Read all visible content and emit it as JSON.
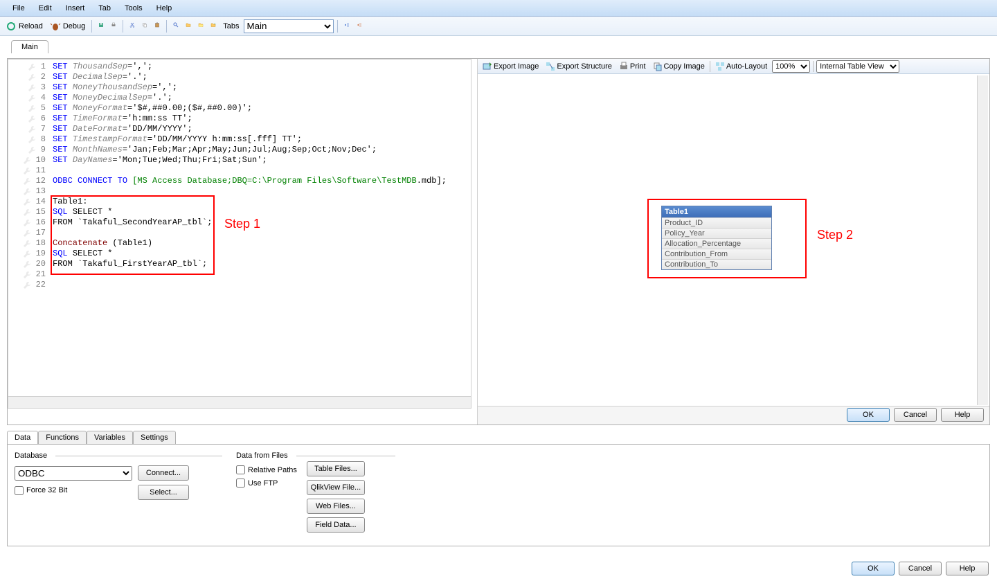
{
  "menu": {
    "file": "File",
    "edit": "Edit",
    "insert": "Insert",
    "tab": "Tab",
    "tools": "Tools",
    "help": "Help"
  },
  "toolbar": {
    "reload": "Reload",
    "debug": "Debug",
    "tabs_label": "Tabs",
    "tabs_value": "Main"
  },
  "main_tab": "Main",
  "code": [
    {
      "n": 1,
      "seg": [
        {
          "c": "kw-set",
          "t": "SET "
        },
        {
          "c": "ident",
          "t": "ThousandSep"
        },
        {
          "c": "",
          "t": "=',';"
        }
      ]
    },
    {
      "n": 2,
      "seg": [
        {
          "c": "kw-set",
          "t": "SET "
        },
        {
          "c": "ident",
          "t": "DecimalSep"
        },
        {
          "c": "",
          "t": "='.';"
        }
      ]
    },
    {
      "n": 3,
      "seg": [
        {
          "c": "kw-set",
          "t": "SET "
        },
        {
          "c": "ident",
          "t": "MoneyThousandSep"
        },
        {
          "c": "",
          "t": "=',';"
        }
      ]
    },
    {
      "n": 4,
      "seg": [
        {
          "c": "kw-set",
          "t": "SET "
        },
        {
          "c": "ident",
          "t": "MoneyDecimalSep"
        },
        {
          "c": "",
          "t": "='.';"
        }
      ]
    },
    {
      "n": 5,
      "seg": [
        {
          "c": "kw-set",
          "t": "SET "
        },
        {
          "c": "ident",
          "t": "MoneyFormat"
        },
        {
          "c": "",
          "t": "='$#,##0.00;($#,##0.00)';"
        }
      ]
    },
    {
      "n": 6,
      "seg": [
        {
          "c": "kw-set",
          "t": "SET "
        },
        {
          "c": "ident",
          "t": "TimeFormat"
        },
        {
          "c": "",
          "t": "='h:mm:ss TT';"
        }
      ]
    },
    {
      "n": 7,
      "seg": [
        {
          "c": "kw-set",
          "t": "SET "
        },
        {
          "c": "ident",
          "t": "DateFormat"
        },
        {
          "c": "",
          "t": "='DD/MM/YYYY';"
        }
      ]
    },
    {
      "n": 8,
      "seg": [
        {
          "c": "kw-set",
          "t": "SET "
        },
        {
          "c": "ident",
          "t": "TimestampFormat"
        },
        {
          "c": "",
          "t": "='DD/MM/YYYY h:mm:ss[.fff] TT';"
        }
      ]
    },
    {
      "n": 9,
      "seg": [
        {
          "c": "kw-set",
          "t": "SET "
        },
        {
          "c": "ident",
          "t": "MonthNames"
        },
        {
          "c": "",
          "t": "='Jan;Feb;Mar;Apr;May;Jun;Jul;Aug;Sep;Oct;Nov;Dec';"
        }
      ]
    },
    {
      "n": 10,
      "seg": [
        {
          "c": "kw-set",
          "t": "SET "
        },
        {
          "c": "ident",
          "t": "DayNames"
        },
        {
          "c": "",
          "t": "='Mon;Tue;Wed;Thu;Fri;Sat;Sun';"
        }
      ]
    },
    {
      "n": 11,
      "seg": []
    },
    {
      "n": 12,
      "seg": [
        {
          "c": "kw-odbc",
          "t": "ODBC "
        },
        {
          "c": "kw-conn",
          "t": "CONNECT "
        },
        {
          "c": "kw-to",
          "t": "TO "
        },
        {
          "c": "bracket",
          "t": "[MS Access Database;DBQ=C:\\Program Files\\Software\\TestMDB"
        },
        {
          "c": "",
          "t": ".mdb];"
        }
      ]
    },
    {
      "n": 13,
      "seg": []
    },
    {
      "n": 14,
      "seg": [
        {
          "c": "",
          "t": "Table1:"
        }
      ]
    },
    {
      "n": 15,
      "seg": [
        {
          "c": "kw-sql",
          "t": "SQL "
        },
        {
          "c": "",
          "t": "SELECT *"
        }
      ]
    },
    {
      "n": 16,
      "seg": [
        {
          "c": "",
          "t": "FROM `Takaful_SecondYearAP_tbl`;"
        }
      ]
    },
    {
      "n": 17,
      "seg": []
    },
    {
      "n": 18,
      "seg": [
        {
          "c": "func",
          "t": "Concatenate"
        },
        {
          "c": "",
          "t": " (Table1)"
        }
      ]
    },
    {
      "n": 19,
      "seg": [
        {
          "c": "kw-sql",
          "t": "SQL "
        },
        {
          "c": "",
          "t": "SELECT *"
        }
      ]
    },
    {
      "n": 20,
      "seg": [
        {
          "c": "",
          "t": "FROM `Takaful_FirstYearAP_tbl`;"
        }
      ]
    },
    {
      "n": 21,
      "seg": []
    },
    {
      "n": 22,
      "seg": []
    }
  ],
  "annotations": {
    "step1": "Step 1",
    "step2": "Step 2"
  },
  "preview_toolbar": {
    "export_image": "Export Image",
    "export_structure": "Export Structure",
    "print": "Print",
    "copy_image": "Copy Image",
    "auto_layout": "Auto-Layout",
    "zoom": "100%",
    "view": "Internal Table View"
  },
  "table": {
    "name": "Table1",
    "fields": [
      "Product_ID",
      "Policy_Year",
      "Allocation_Percentage",
      "Contribution_From",
      "Contribution_To"
    ]
  },
  "dialog_buttons": {
    "ok": "OK",
    "cancel": "Cancel",
    "help": "Help"
  },
  "bottom_tabs": {
    "data": "Data",
    "functions": "Functions",
    "variables": "Variables",
    "settings": "Settings"
  },
  "data_panel": {
    "database_legend": "Database",
    "db_type": "ODBC",
    "connect": "Connect...",
    "select": "Select...",
    "force32": "Force 32 Bit",
    "files_legend": "Data from Files",
    "relpaths": "Relative Paths",
    "useftp": "Use FTP",
    "table_files": "Table Files...",
    "qlikview_file": "QlikView File...",
    "web_files": "Web Files...",
    "field_data": "Field Data..."
  }
}
